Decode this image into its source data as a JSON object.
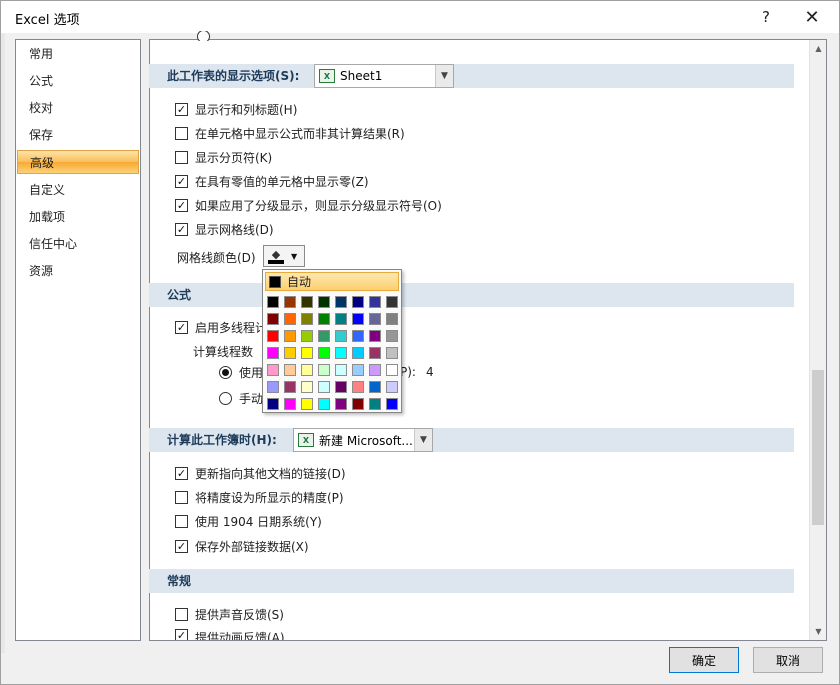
{
  "window": {
    "title": "Excel 选项",
    "help": "?",
    "close": "✕"
  },
  "sidebar": {
    "items": [
      {
        "label": "常用"
      },
      {
        "label": "公式"
      },
      {
        "label": "校对"
      },
      {
        "label": "保存"
      },
      {
        "label": "高级",
        "active": true
      },
      {
        "label": "自定义"
      },
      {
        "label": "加载项"
      },
      {
        "label": "信任中心"
      },
      {
        "label": "资源"
      }
    ]
  },
  "worksheet_section": {
    "title": "此工作表的显示选项(S):",
    "sheet_combo": "Sheet1",
    "options": [
      {
        "label": "显示行和列标题(H)",
        "checked": true
      },
      {
        "label": "在单元格中显示公式而非其计算结果(R)",
        "checked": false
      },
      {
        "label": "显示分页符(K)",
        "checked": false
      },
      {
        "label": "在具有零值的单元格中显示零(Z)",
        "checked": true
      },
      {
        "label": "如果应用了分级显示，则显示分级显示符号(O)",
        "checked": true
      },
      {
        "label": "显示网格线(D)",
        "checked": true
      }
    ],
    "gridline_color_label": "网格线颜色(D)"
  },
  "palette": {
    "auto_label": "自动",
    "rows": [
      [
        "#000000",
        "#993300",
        "#333300",
        "#003300",
        "#003366",
        "#000080",
        "#333399",
        "#333333"
      ],
      [
        "#800000",
        "#ff6600",
        "#808000",
        "#008000",
        "#008080",
        "#0000ff",
        "#666699",
        "#808080"
      ],
      [
        "#ff0000",
        "#ff9900",
        "#99cc00",
        "#339966",
        "#33cccc",
        "#3366ff",
        "#800080",
        "#969696"
      ],
      [
        "#ff00ff",
        "#ffcc00",
        "#ffff00",
        "#00ff00",
        "#00ffff",
        "#00ccff",
        "#993366",
        "#c0c0c0"
      ],
      [
        "#ff99cc",
        "#ffcc99",
        "#ffff99",
        "#ccffcc",
        "#ccffff",
        "#99ccff",
        "#cc99ff",
        "#ffffff"
      ],
      [
        "#9999ff",
        "#993366",
        "#ffffcc",
        "#ccffff",
        "#660066",
        "#ff8080",
        "#0066cc",
        "#ccccff"
      ],
      [
        "#000080",
        "#ff00ff",
        "#ffff00",
        "#00ffff",
        "#800080",
        "#800000",
        "#008080",
        "#0000ff"
      ]
    ]
  },
  "formula_section": {
    "title": "公式",
    "multithread_label": "启用多线程计",
    "threads_label": "计算线程数",
    "radio_use": "使用",
    "radio_use_suffix": "P):",
    "thread_count": "4",
    "radio_manual": "手动"
  },
  "workbook_section": {
    "title": "计算此工作簿时(H):",
    "workbook_combo": "新建 Microsoft...",
    "options": [
      {
        "label": "更新指向其他文档的链接(D)",
        "checked": true
      },
      {
        "label": "将精度设为所显示的精度(P)",
        "checked": false
      },
      {
        "label": "使用 1904 日期系统(Y)",
        "checked": false
      },
      {
        "label": "保存外部链接数据(X)",
        "checked": true
      }
    ]
  },
  "general_section": {
    "title": "常规",
    "options": [
      {
        "label": "提供声音反馈(S)",
        "checked": false
      },
      {
        "label": "提供动画反馈(A)",
        "checked": true
      }
    ]
  },
  "footer": {
    "ok": "确定",
    "cancel": "取消"
  }
}
